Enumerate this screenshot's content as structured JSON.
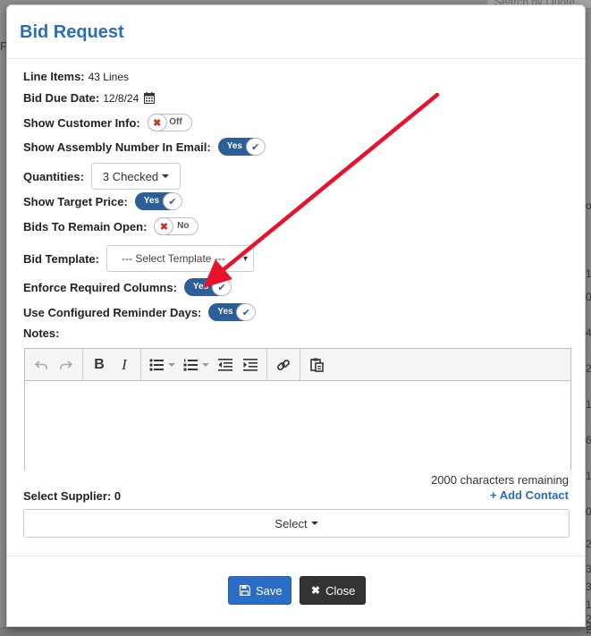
{
  "background": {
    "search_placeholder": "Search by Quote",
    "left_fragment": "F",
    "right_digits": [
      "o",
      "1",
      "0",
      "4",
      "2",
      "1",
      "6",
      "1",
      "0",
      "2",
      "3",
      "3",
      "1",
      "2",
      "2",
      "2"
    ]
  },
  "modal": {
    "title": "Bid Request",
    "line_items": {
      "label": "Line Items:",
      "value": "43 Lines"
    },
    "bid_due_date": {
      "label": "Bid Due Date:",
      "value": "12/8/24",
      "icon": "calendar-icon"
    },
    "show_customer_info": {
      "label": "Show Customer Info:",
      "state": "Off"
    },
    "show_assembly_number": {
      "label": "Show Assembly Number In Email:",
      "state": "Yes"
    },
    "quantities": {
      "label": "Quantities:",
      "button": "3 Checked"
    },
    "show_target_price": {
      "label": "Show Target Price:",
      "state": "Yes"
    },
    "bids_remain_open": {
      "label": "Bids To Remain Open:",
      "state": "No"
    },
    "bid_template": {
      "label": "Bid Template:",
      "selected": "--- Select Template ---"
    },
    "enforce_required_columns": {
      "label": "Enforce Required Columns:",
      "state": "Yes"
    },
    "use_reminder_days": {
      "label": "Use Configured Reminder Days:",
      "state": "Yes"
    },
    "notes": {
      "label": "Notes:",
      "toolbar": [
        "undo-icon",
        "redo-icon",
        "bold-icon",
        "italic-icon",
        "bullet-list-icon",
        "numbered-list-icon",
        "outdent-icon",
        "indent-icon",
        "link-icon",
        "paste-icon"
      ],
      "chars_remaining": "2000 characters remaining"
    },
    "select_supplier": {
      "label": "Select Supplier: 0",
      "add_contact": "+ Add Contact",
      "select_button": "Select"
    },
    "footer": {
      "save": "Save",
      "close": "Close"
    }
  },
  "colors": {
    "title": "#2a6db8",
    "toggle_on": "#2c5e99",
    "save_button": "#2b6cc4",
    "close_button": "#333333",
    "annotation_arrow": "#e8122d"
  }
}
